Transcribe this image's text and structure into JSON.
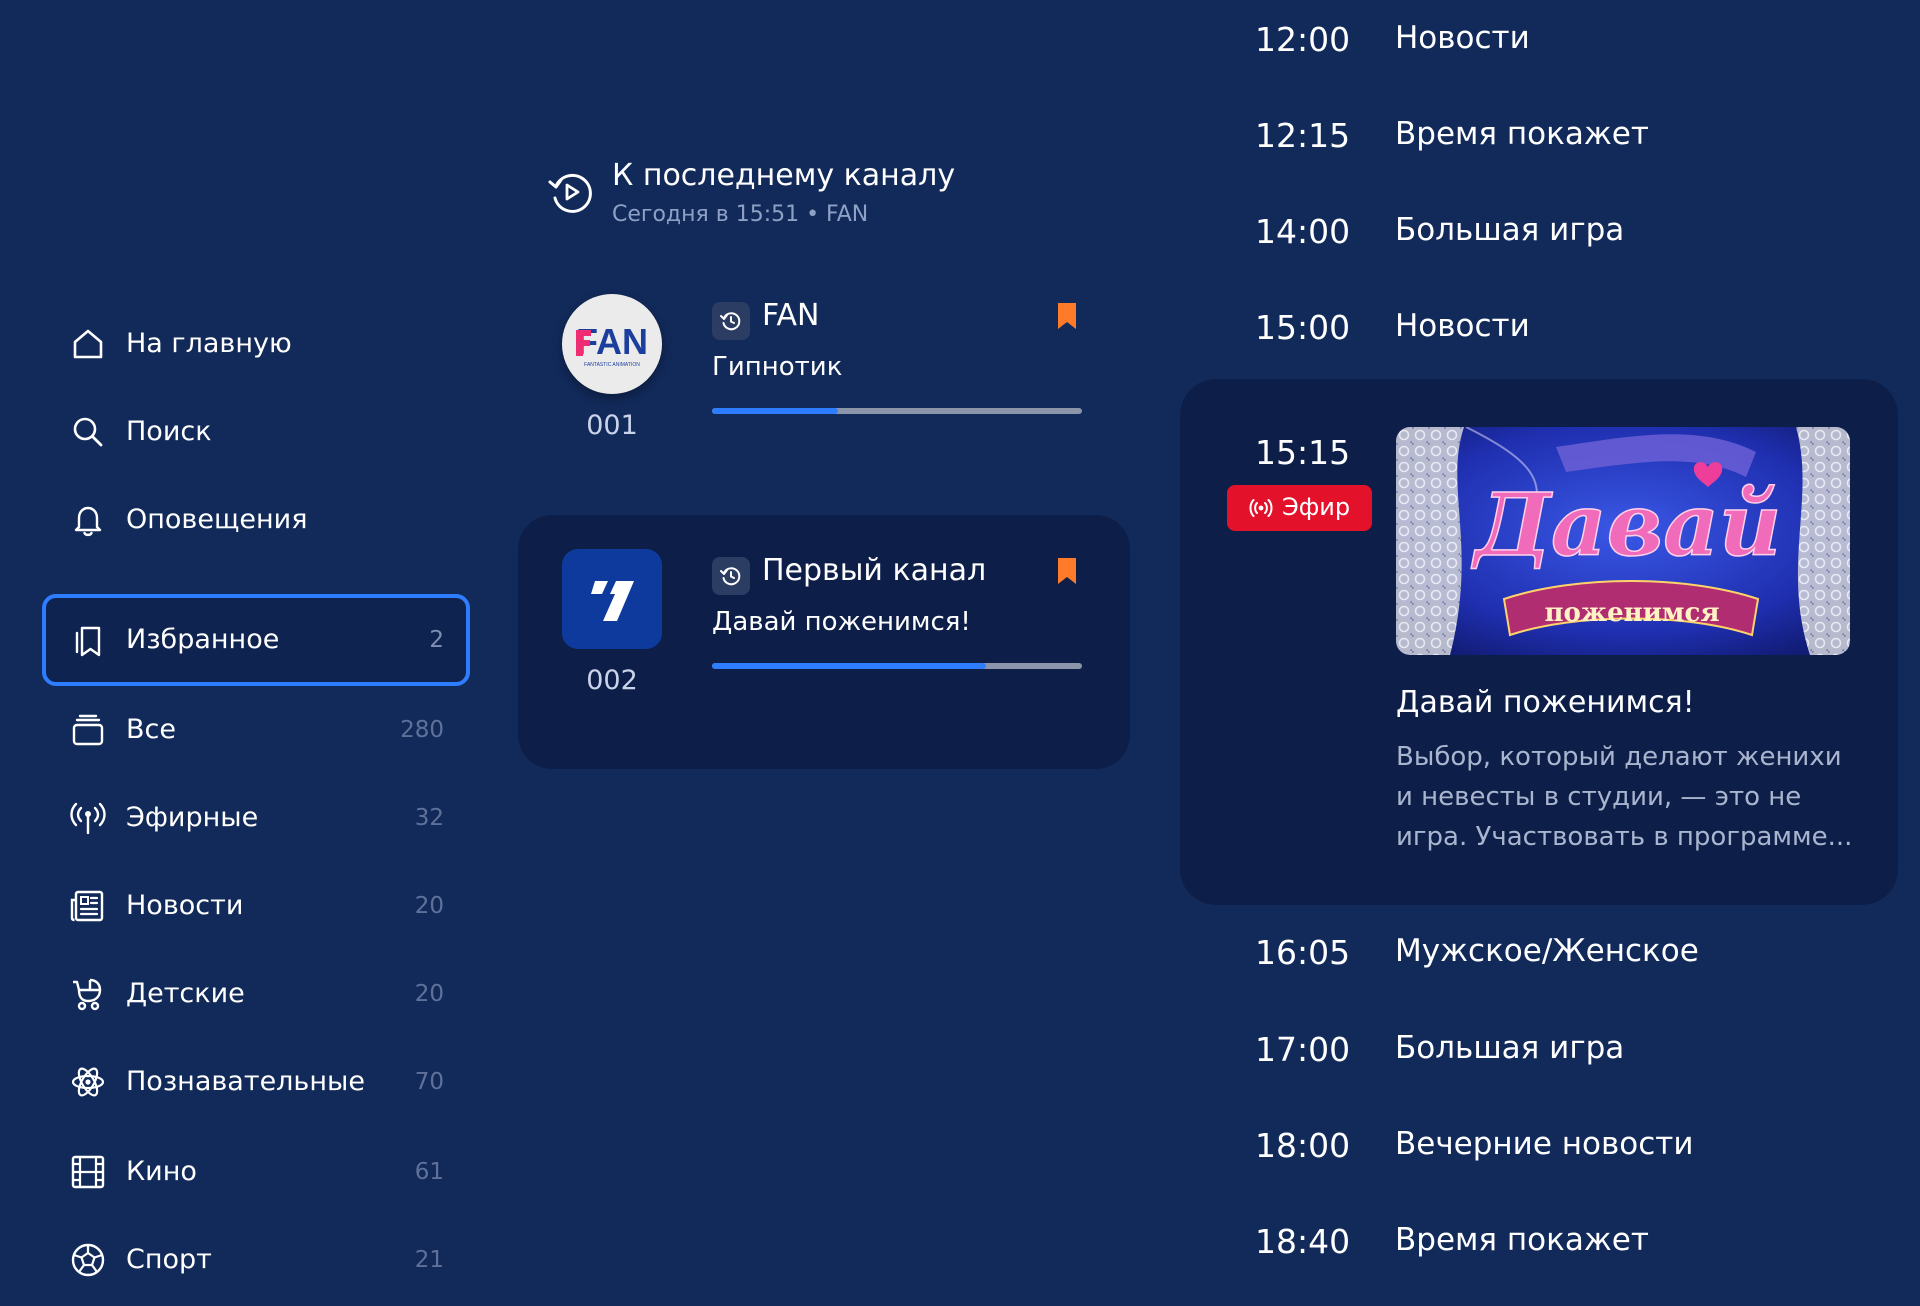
{
  "colors": {
    "background": "#122a5a",
    "card": "#0d1f49",
    "accent": "#2f7dff",
    "bookmark": "#ff7a29",
    "live": "#e4112a"
  },
  "sidebar": {
    "items": [
      {
        "label": "На главную",
        "icon": "home-icon"
      },
      {
        "label": "Поиск",
        "icon": "search-icon"
      },
      {
        "label": "Оповещения",
        "icon": "bell-icon"
      },
      {
        "label": "Избранное",
        "count": "2",
        "icon": "bookmarks-icon",
        "selected": true
      },
      {
        "label": "Все",
        "count": "280",
        "icon": "stack-icon"
      },
      {
        "label": "Эфирные",
        "count": "32",
        "icon": "broadcast-icon"
      },
      {
        "label": "Новости",
        "count": "20",
        "icon": "newspaper-icon"
      },
      {
        "label": "Детские",
        "count": "20",
        "icon": "stroller-icon"
      },
      {
        "label": "Познавательные",
        "count": "70",
        "icon": "atom-icon"
      },
      {
        "label": "Кино",
        "count": "61",
        "icon": "film-icon"
      },
      {
        "label": "Спорт",
        "count": "21",
        "icon": "ball-icon"
      }
    ]
  },
  "last_channel": {
    "title": "К последнему каналу",
    "subtitle": "Сегодня в 15:51 • FAN"
  },
  "channels": [
    {
      "number": "001",
      "name": "FAN",
      "program": "Гипнотик",
      "progress": 0.34,
      "logo": "fan-logo",
      "logo_text": "FAN",
      "logo_subtext": "FANTASTIC ANIMATION"
    },
    {
      "number": "002",
      "name": "Первый канал",
      "program": "Давай поженимся!",
      "progress": 0.74,
      "logo": "perviy-kanal-logo",
      "active": true
    }
  ],
  "schedule": {
    "before": [
      {
        "time": "12:00",
        "title": "Новости"
      },
      {
        "time": "12:15",
        "title": "Время покажет"
      },
      {
        "time": "14:00",
        "title": "Большая игра"
      },
      {
        "time": "15:00",
        "title": "Новости"
      }
    ],
    "current": {
      "time": "15:15",
      "badge": "Эфир",
      "title": "Давай поженимся!",
      "description": "Выбор, который делают женихи и невесты в студии, — это не игра. Участвовать в программе...",
      "thumbnail_text_1": "Давай",
      "thumbnail_text_2": "поженимся"
    },
    "after": [
      {
        "time": "16:05",
        "title": "Мужское/Женское"
      },
      {
        "time": "17:00",
        "title": "Большая игра"
      },
      {
        "time": "18:00",
        "title": "Вечерние новости"
      },
      {
        "time": "18:40",
        "title": "Время покажет"
      }
    ]
  }
}
